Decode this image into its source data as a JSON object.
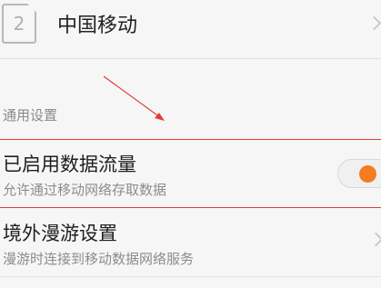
{
  "sim": {
    "slot_number": "2",
    "carrier_name": "中国移动"
  },
  "general_section": {
    "header": "通用设置"
  },
  "mobile_data": {
    "title": "已启用数据流量",
    "subtitle": "允许通过移动网络存取数据",
    "enabled": true,
    "toggle_color": "#f47b20"
  },
  "roaming": {
    "title": "境外漫游设置",
    "subtitle": "漫游时连接到移动数据网络服务"
  },
  "annotations": {
    "highlight_color": "#e43b35",
    "arrow_color": "#e43b35"
  }
}
